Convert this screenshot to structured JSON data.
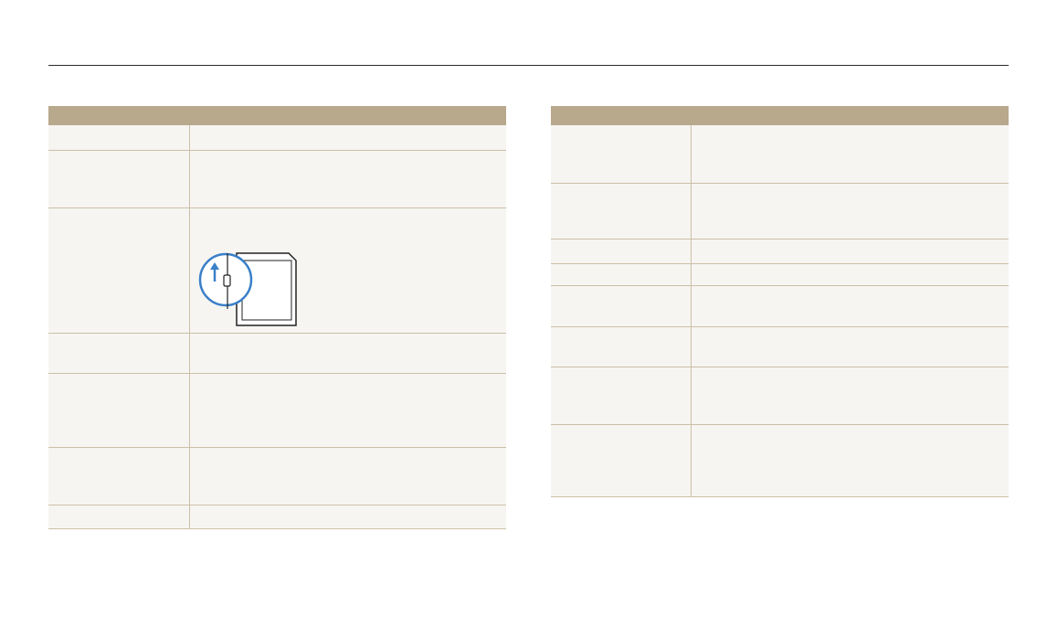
{
  "document": {
    "left_table": {
      "header": [
        "",
        ""
      ],
      "rows": [
        {
          "label": "",
          "description": ""
        },
        {
          "label": "",
          "description": ""
        },
        {
          "label": "",
          "description": "",
          "figure": "sd-card-lock-switch-illustration"
        },
        {
          "label": "",
          "description": ""
        },
        {
          "label": "",
          "description": ""
        },
        {
          "label": "",
          "description": ""
        },
        {
          "label": "",
          "description": ""
        }
      ]
    },
    "right_table": {
      "header": [
        "",
        ""
      ],
      "rows": [
        {
          "label": "",
          "description": ""
        },
        {
          "label": "",
          "description": ""
        },
        {
          "label": "",
          "description": ""
        },
        {
          "label": "",
          "description": ""
        },
        {
          "label": "",
          "description": ""
        },
        {
          "label": "",
          "description": ""
        },
        {
          "label": "",
          "description": ""
        },
        {
          "label": "",
          "description": ""
        }
      ]
    }
  },
  "colors": {
    "header_bg": "#b8a88c",
    "row_bg": "#f6f5f2",
    "rule": "#cdbfa8",
    "top_rule": "#2b2b2b",
    "callout_blue": "#3a7fc8"
  }
}
